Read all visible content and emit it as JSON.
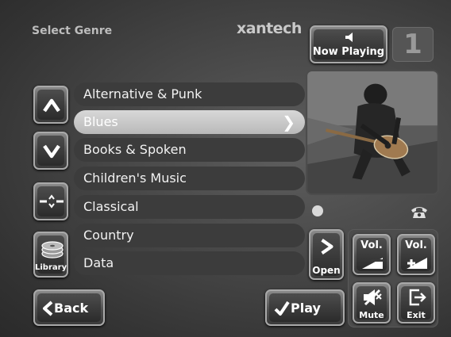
{
  "header": {
    "title": "Select Genre",
    "brand": "xantech",
    "now_playing_label": "Now Playing",
    "zone_number": "1"
  },
  "nav": {
    "library_label": "Library",
    "back_label": "Back",
    "play_label": "Play",
    "open_label": "Open"
  },
  "genres": {
    "items": [
      {
        "label": "Alternative & Punk"
      },
      {
        "label": "Blues"
      },
      {
        "label": "Books & Spoken"
      },
      {
        "label": "Children's Music"
      },
      {
        "label": "Classical"
      },
      {
        "label": "Country"
      },
      {
        "label": "Data"
      }
    ],
    "selected_index": 1
  },
  "controls": {
    "vol_down_label": "Vol.",
    "vol_up_label": "Vol.",
    "mute_label": "Mute",
    "exit_label": "Exit"
  },
  "icons": {
    "scroll_up": "arrow-up-icon",
    "scroll_down": "arrow-down-icon",
    "jump": "jump-icon",
    "library": "disc-stack-icon",
    "selected_row": "chevron-right-icon",
    "speaker": "speaker-icon",
    "phone": "phone-icon",
    "status": "status-dot-icon"
  },
  "colors": {
    "background": "#464646",
    "selected_row": "#c8c8c8",
    "row": "#3c3c3c",
    "button_border": "#a9a9a9"
  }
}
